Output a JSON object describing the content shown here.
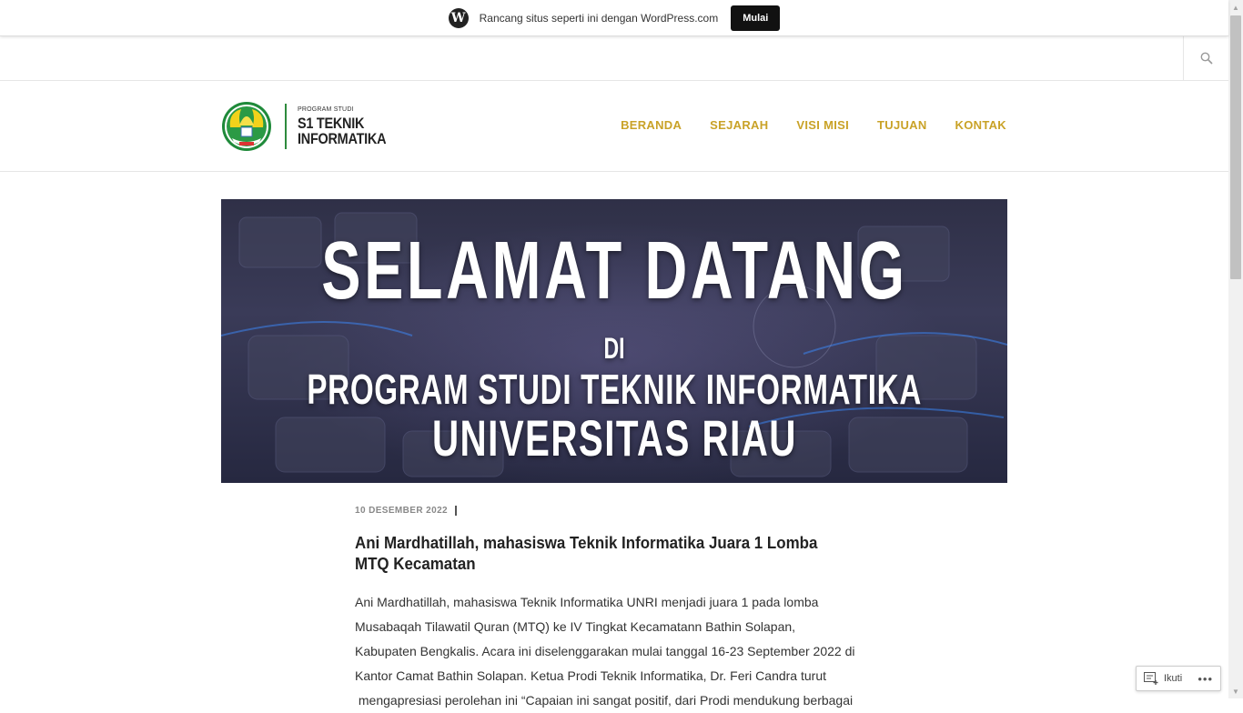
{
  "wp_bar": {
    "message": "Rancang situs seperti ini dengan WordPress.com",
    "button_label": "Mulai"
  },
  "header": {
    "brand_small": "PROGRAM STUDI",
    "brand_line1": "S1 TEKNIK",
    "brand_line2": "INFORMATIKA",
    "nav": [
      "BERANDA",
      "SEJARAH",
      "VISI MISI",
      "TUJUAN",
      "KONTAK"
    ]
  },
  "hero": {
    "line1": "SELAMAT DATANG",
    "line2": "DI",
    "line3": "PROGRAM STUDI TEKNIK INFORMATIKA",
    "line4": "UNIVERSITAS RIAU"
  },
  "post": {
    "date": "10 DESEMBER 2022",
    "title": "Ani Mardhatillah, mahasiswa Teknik Informatika Juara 1 Lomba MTQ Kecamatan",
    "body_lines": [
      "Ani Mardhatillah, mahasiswa Teknik Informatika UNRI menjadi juara 1 pada lomba",
      "Musabaqah Tilawatil Quran (MTQ)  ke IV Tingkat Kecamatann Bathin Solapan,",
      "Kabupaten Bengkalis. Acara ini diselenggarakan mulai tanggal 16-23 September 2022 di",
      "Kantor Camat Bathin Solapan. Ketua Prodi Teknik Informatika,  Dr. Feri Candra turut",
      " mengapresiasi perolehan ini “Capaian ini sangat positif, dari Prodi mendukung berbagai"
    ]
  },
  "follow": {
    "label": "Ikuti",
    "more": "•••"
  },
  "colors": {
    "nav": "#c9a227",
    "brand_divider": "#2e8b3d"
  },
  "icons": {
    "wp_logo": "wordpress-logo-icon",
    "search": "search-icon",
    "follow": "reader-follow-icon"
  }
}
